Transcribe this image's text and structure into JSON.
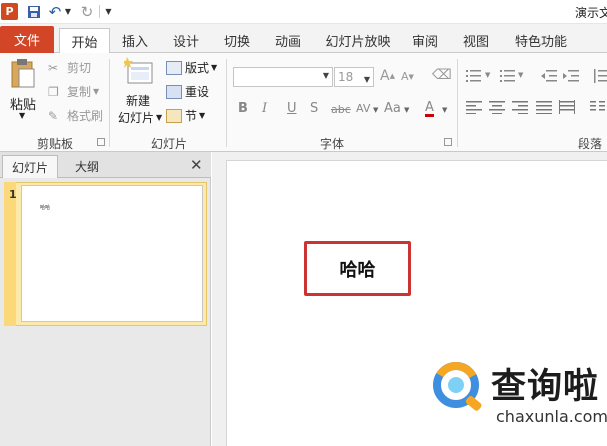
{
  "window": {
    "title": "演示文"
  },
  "qat": {
    "logo_letter": "P"
  },
  "tabs": {
    "file": "文件",
    "items": [
      "开始",
      "插入",
      "设计",
      "切换",
      "动画",
      "幻灯片放映",
      "审阅",
      "视图",
      "特色功能"
    ]
  },
  "ribbon": {
    "clipboard": {
      "label": "剪贴板",
      "paste": "粘贴",
      "cut": "剪切",
      "copy": "复制",
      "format_painter": "格式刷"
    },
    "slides": {
      "label": "幻灯片",
      "new_slide_line1": "新建",
      "new_slide_line2": "幻灯片",
      "layout": "版式",
      "reset": "重设",
      "section": "节"
    },
    "font": {
      "label": "字体",
      "font_name": "",
      "font_size": "18",
      "grow": "A",
      "shrink": "A",
      "bold": "B",
      "italic": "I",
      "underline": "U",
      "shadow": "S",
      "strike": "abc",
      "spacing": "AV",
      "case": "Aa",
      "color": "A"
    },
    "paragraph": {
      "label": "段落"
    }
  },
  "panel": {
    "tabs": [
      "幻灯片",
      "大纲"
    ],
    "slide_number": "1",
    "thumb_text": "哈哈"
  },
  "slide": {
    "text": "哈哈"
  },
  "watermark": {
    "title": "查询啦",
    "url": "chaxunla.com"
  },
  "colors": {
    "file_tab": "#d24627",
    "textbox_border": "#cc3333",
    "thumb_highlight": "#fde9a9"
  }
}
